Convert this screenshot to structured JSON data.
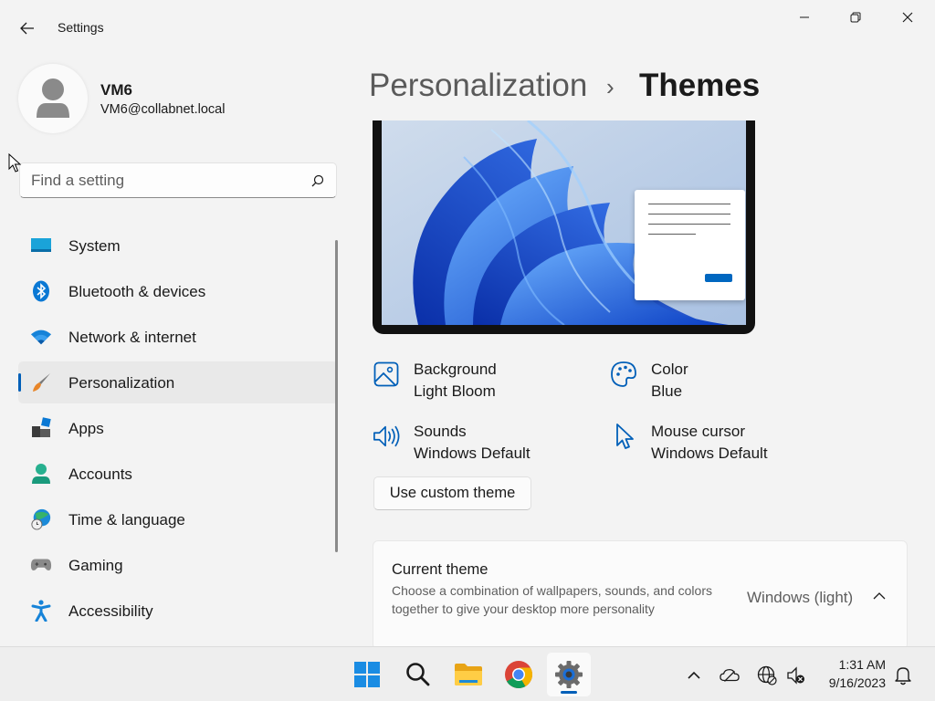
{
  "window": {
    "title": "Settings"
  },
  "user": {
    "name": "VM6",
    "email": "VM6@collabnet.local"
  },
  "search": {
    "placeholder": "Find a setting"
  },
  "sidebar": {
    "items": [
      {
        "label": "System",
        "icon": "system-icon"
      },
      {
        "label": "Bluetooth & devices",
        "icon": "bluetooth-icon"
      },
      {
        "label": "Network & internet",
        "icon": "wifi-icon"
      },
      {
        "label": "Personalization",
        "icon": "paintbrush-icon",
        "active": true
      },
      {
        "label": "Apps",
        "icon": "apps-icon"
      },
      {
        "label": "Accounts",
        "icon": "accounts-icon"
      },
      {
        "label": "Time & language",
        "icon": "globe-clock-icon"
      },
      {
        "label": "Gaming",
        "icon": "gamepad-icon"
      },
      {
        "label": "Accessibility",
        "icon": "accessibility-icon"
      }
    ]
  },
  "breadcrumb": {
    "parent": "Personalization",
    "separator": "›",
    "current": "Themes"
  },
  "properties": {
    "background": {
      "title": "Background",
      "value": "Light Bloom"
    },
    "color": {
      "title": "Color",
      "value": "Blue"
    },
    "sounds": {
      "title": "Sounds",
      "value": "Windows Default"
    },
    "mouse_cursor": {
      "title": "Mouse cursor",
      "value": "Windows Default"
    }
  },
  "custom_theme_button": "Use custom theme",
  "current_theme": {
    "title": "Current theme",
    "description": "Choose a combination of wallpapers, sounds, and colors together to give your desktop more personality",
    "value": "Windows (light)"
  },
  "taskbar": {
    "apps": [
      "start-icon",
      "search-icon",
      "file-explorer-icon",
      "chrome-icon",
      "settings-icon"
    ],
    "tray": [
      "chevron-up-icon",
      "onedrive-icon",
      "network-icon",
      "volume-muted-icon"
    ],
    "time": "1:31 AM",
    "date": "9/16/2023"
  },
  "colors": {
    "accent": "#005fb8",
    "wallpaper_blue": "#1e5ae6"
  }
}
